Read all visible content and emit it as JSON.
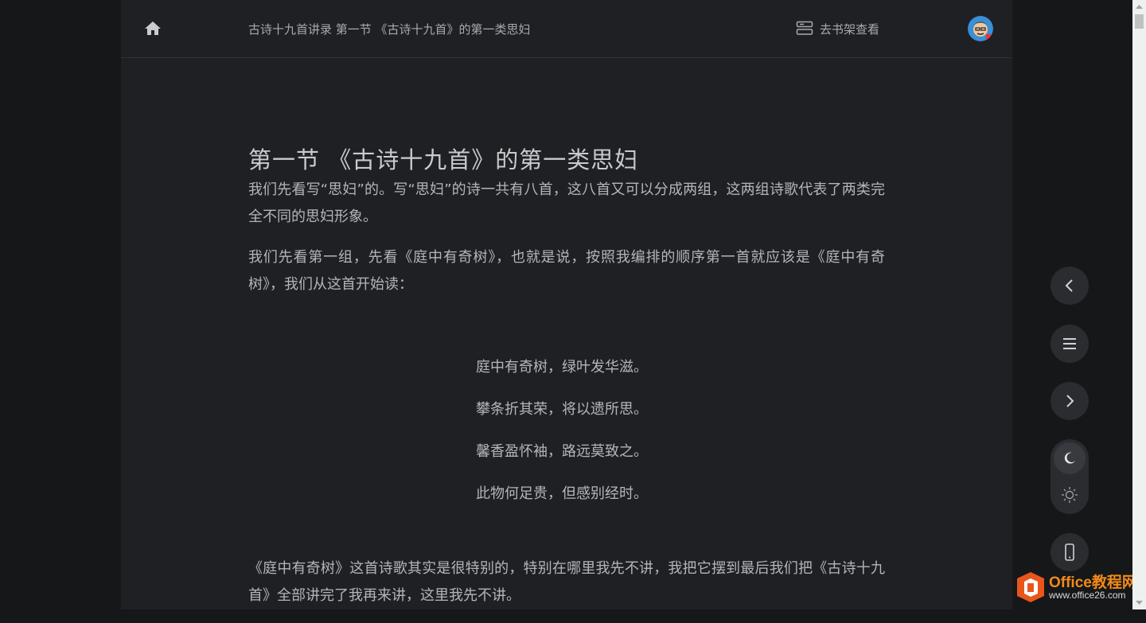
{
  "header": {
    "breadcrumb": "古诗十九首讲录 第一节 《古诗十九首》的第一类思妇",
    "shelf_link": "去书架查看",
    "icons": {
      "home": "home-icon",
      "shelf": "bookshelf-icon",
      "avatar": "user-avatar"
    }
  },
  "chapter": {
    "title": "第一节 《古诗十九首》的第一类思妇",
    "paragraphs_before": [
      "我们先看写“思妇”的。写“思妇”的诗一共有八首，这八首又可以分成两组，这两组诗歌代表了两类完全不同的思妇形象。",
      "我们先看第一组，先看《庭中有奇树》，也就是说，按照我编排的顺序第一首就应该是《庭中有奇树》，我们从这首开始读："
    ],
    "poem": [
      "庭中有奇树，绿叶发华滋。",
      "攀条折其荣，将以遗所思。",
      "馨香盈怀袖，路远莫致之。",
      "此物何足贵，但感别经时。"
    ],
    "paragraphs_after": [
      "《庭中有奇树》这首诗歌其实是很特别的，特别在哪里我先不讲，我把它摆到最后我们把《古诗十九首》全部讲完了我再来讲，这里我先不讲。"
    ]
  },
  "controls": {
    "icons": [
      "chevron-left-icon",
      "menu-icon",
      "chevron-right-icon",
      "moon-icon",
      "sun-icon",
      "phone-icon"
    ],
    "active_theme": "dark"
  },
  "watermark": {
    "brand": "Office教程网",
    "url": "www.office26.com"
  },
  "colors": {
    "page_bg": "#161719",
    "reader_bg": "#1f2023",
    "text": "#b3b6b9",
    "button_bg": "#2b2c30",
    "brand_orange": "#f28a1a"
  }
}
